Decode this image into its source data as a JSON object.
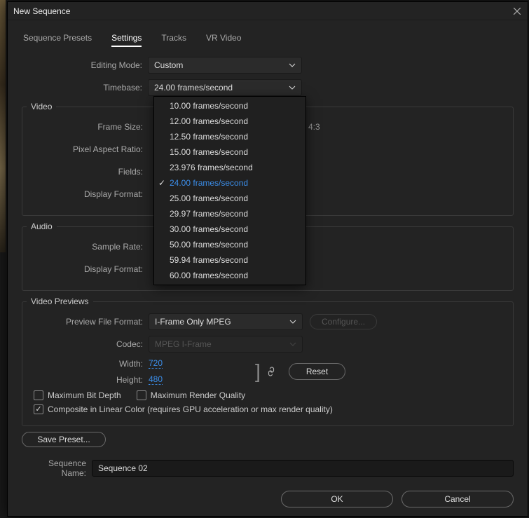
{
  "title": "New Sequence",
  "tabs": {
    "presets": "Sequence Presets",
    "settings": "Settings",
    "tracks": "Tracks",
    "vr": "VR Video"
  },
  "labels": {
    "editing_mode": "Editing Mode:",
    "timebase": "Timebase:",
    "frame_size": "Frame Size:",
    "pixel_aspect": "Pixel Aspect Ratio:",
    "fields": "Fields:",
    "display_format_v": "Display Format:",
    "sample_rate": "Sample Rate:",
    "display_format_a": "Display Format:",
    "preview_format": "Preview File Format:",
    "codec": "Codec:",
    "width": "Width:",
    "height": "Height:",
    "sequence_name": "Sequence Name:"
  },
  "groups": {
    "video": "Video",
    "audio": "Audio",
    "previews": "Video Previews"
  },
  "values": {
    "editing_mode": "Custom",
    "timebase": "24.00  frames/second",
    "frame_size_suffix": "4:3",
    "preview_format": "I-Frame Only MPEG",
    "codec": "MPEG I-Frame",
    "width": "720",
    "height": "480",
    "sequence_name": "Sequence 02"
  },
  "buttons": {
    "configure": "Configure...",
    "reset": "Reset",
    "save_preset": "Save Preset...",
    "ok": "OK",
    "cancel": "Cancel"
  },
  "checkboxes": {
    "max_bit_depth": "Maximum Bit Depth",
    "max_render_quality": "Maximum Render Quality",
    "composite_linear": "Composite in Linear Color (requires GPU acceleration or max render quality)"
  },
  "timebase_options": [
    {
      "label": "10.00  frames/second",
      "selected": false
    },
    {
      "label": "12.00  frames/second",
      "selected": false
    },
    {
      "label": "12.50  frames/second",
      "selected": false
    },
    {
      "label": "15.00  frames/second",
      "selected": false
    },
    {
      "label": "23.976  frames/second",
      "selected": false
    },
    {
      "label": "24.00  frames/second",
      "selected": true
    },
    {
      "label": "25.00  frames/second",
      "selected": false
    },
    {
      "label": "29.97  frames/second",
      "selected": false
    },
    {
      "label": "30.00  frames/second",
      "selected": false
    },
    {
      "label": "50.00  frames/second",
      "selected": false
    },
    {
      "label": "59.94  frames/second",
      "selected": false
    },
    {
      "label": "60.00  frames/second",
      "selected": false
    }
  ]
}
